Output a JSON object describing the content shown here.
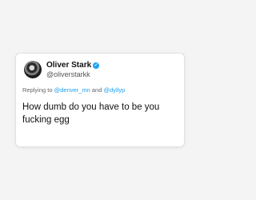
{
  "tweet": {
    "display_name": "Oliver Stark",
    "handle": "@oliverstarkk",
    "reply_prefix": "Replying to",
    "mention_1": "@denver_mn",
    "reply_conjunction": "and",
    "mention_2": "@dyllyp",
    "text": "How dumb do you have to be you fucking egg",
    "verified_color": "#1da1f2",
    "avatar_icon": "profile-photo",
    "verified_icon": "verified-badge-icon"
  }
}
